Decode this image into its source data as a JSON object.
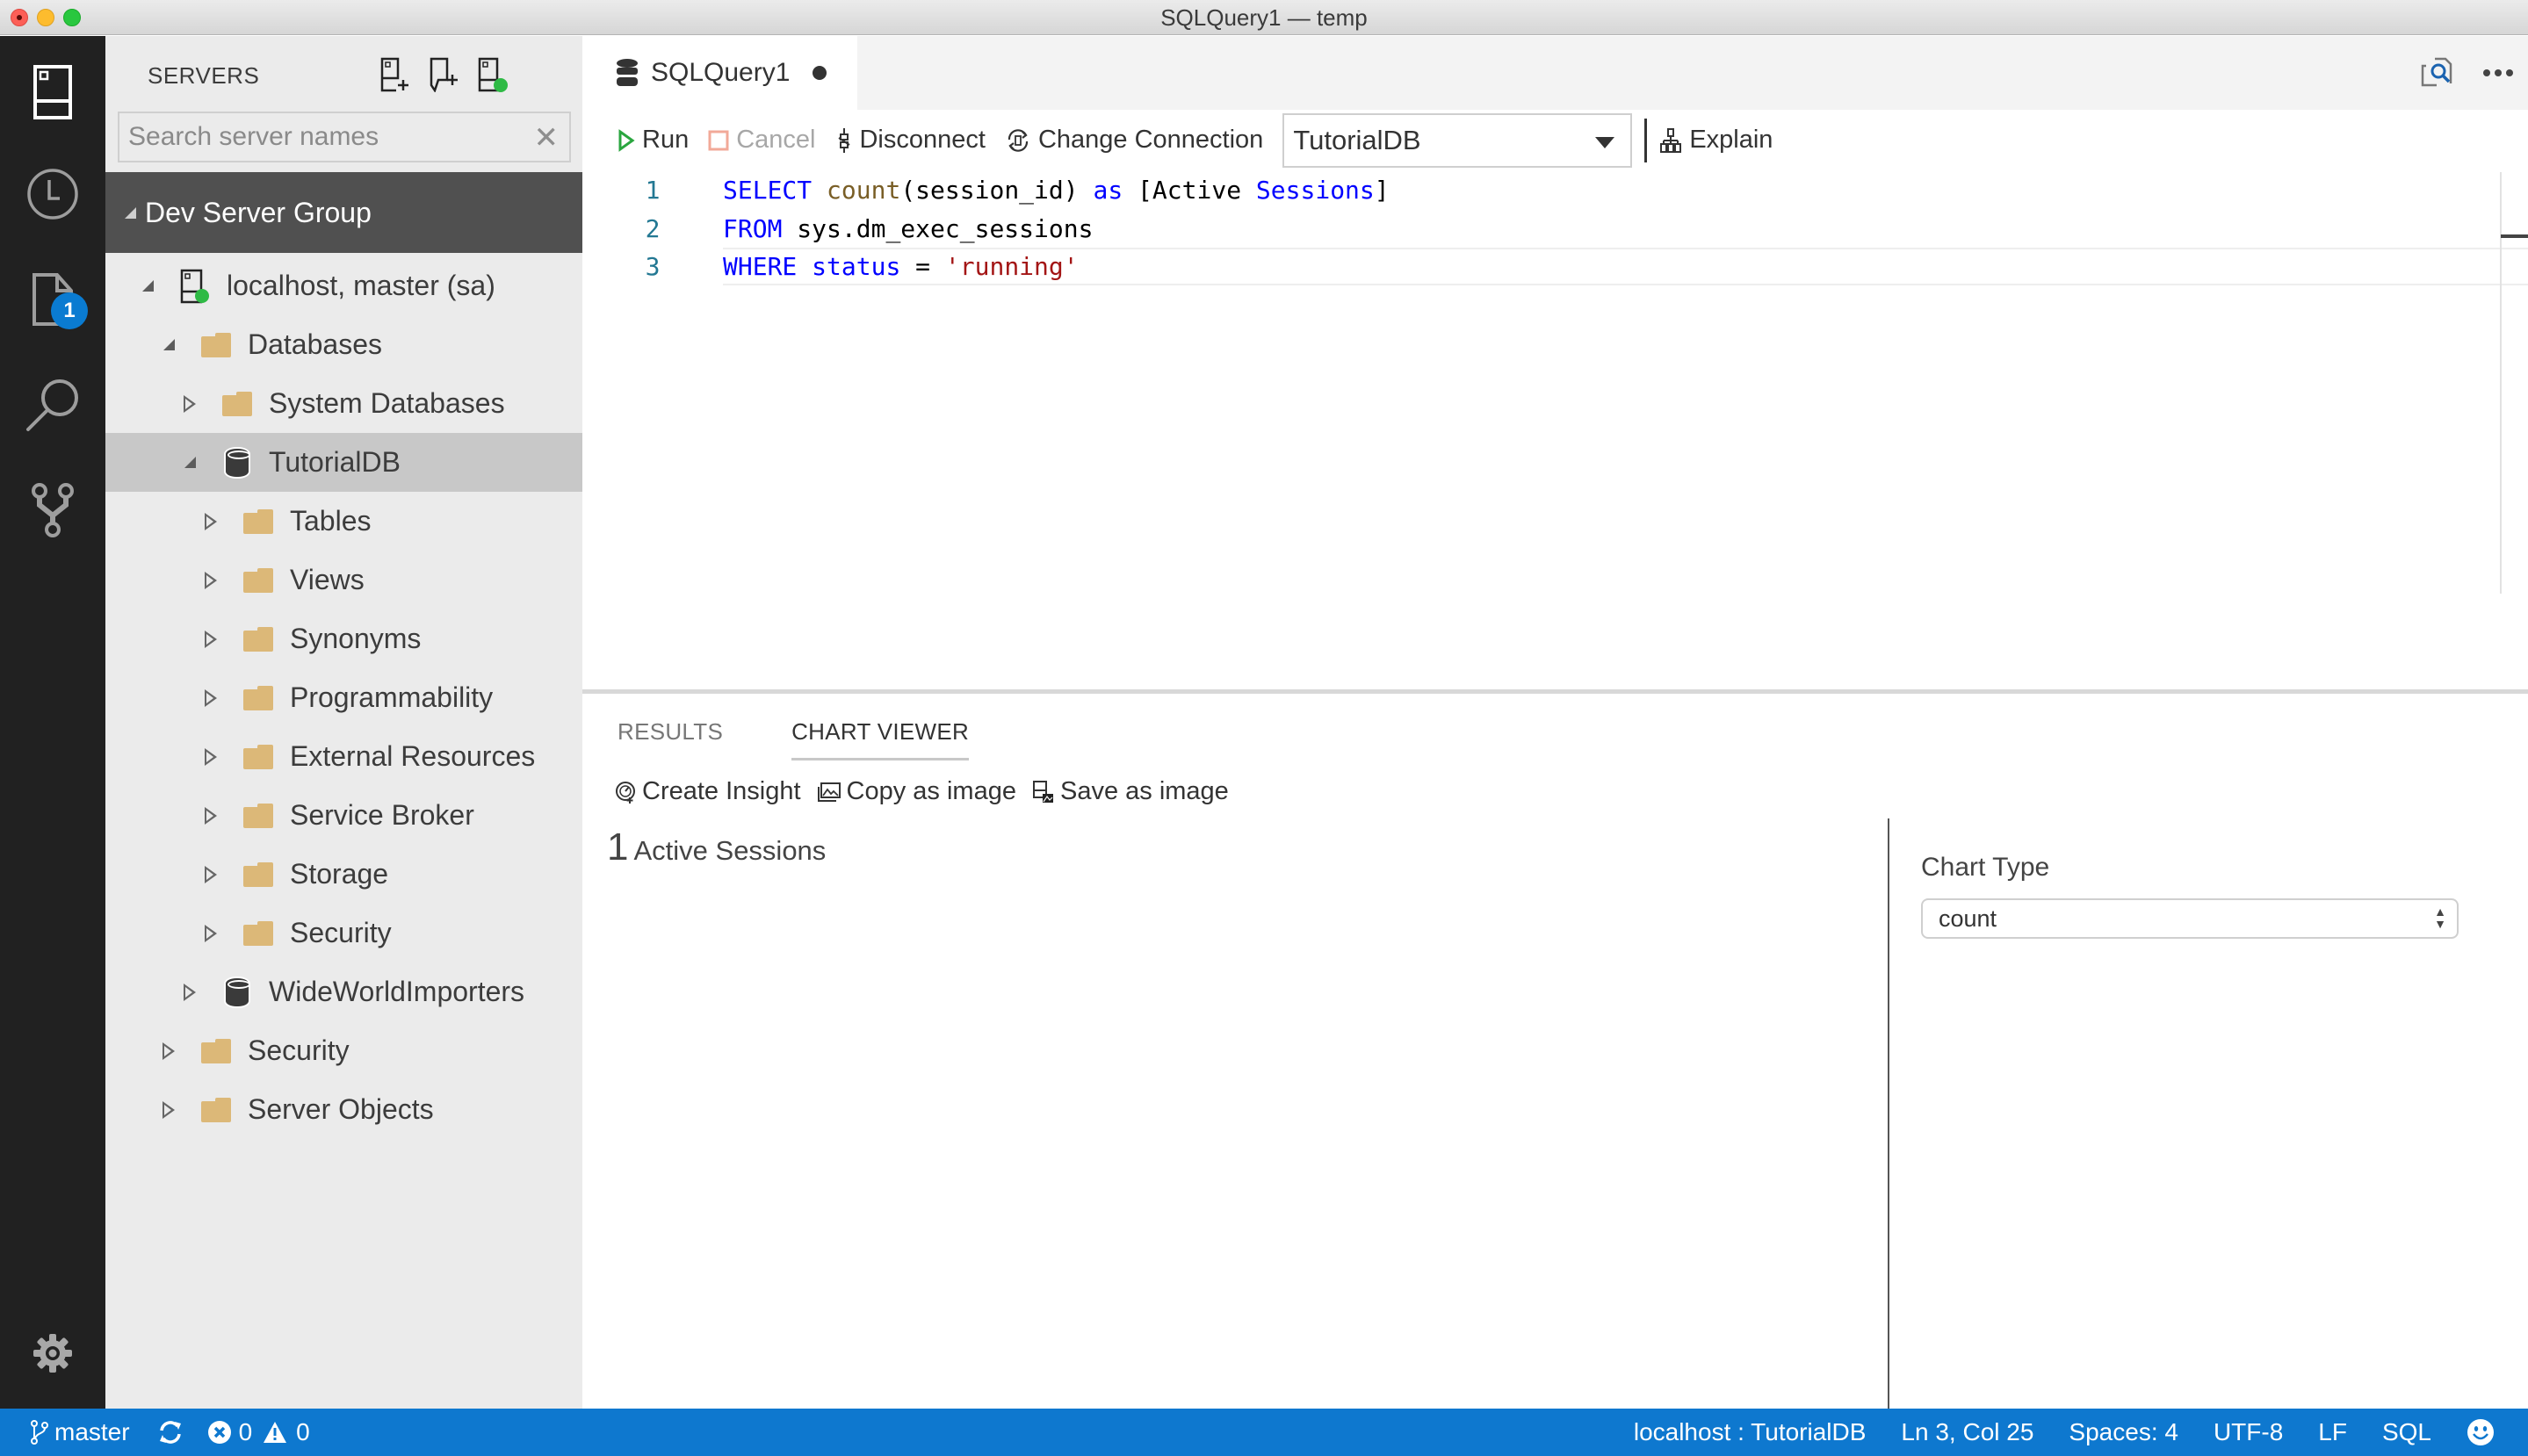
{
  "window": {
    "title": "SQLQuery1 — temp"
  },
  "activity_bar": {
    "items": [
      {
        "name": "servers",
        "icon": "server-icon"
      },
      {
        "name": "task-history",
        "icon": "clock-icon"
      },
      {
        "name": "explorer",
        "icon": "file-icon",
        "badge": "1"
      },
      {
        "name": "search",
        "icon": "search-icon"
      },
      {
        "name": "source-control",
        "icon": "git-branch-icon"
      }
    ],
    "settings_icon": "gear-icon"
  },
  "sidebar": {
    "title": "SERVERS",
    "actions": [
      {
        "name": "new-connection",
        "icon": "add-server-icon"
      },
      {
        "name": "new-server-group",
        "icon": "add-group-icon"
      },
      {
        "name": "active-connections",
        "icon": "server-connected-icon"
      }
    ],
    "search": {
      "placeholder": "Search server names",
      "value": ""
    },
    "group": {
      "label": "Dev Server Group",
      "expanded": true
    },
    "tree": [
      {
        "label": "localhost, master (sa)",
        "level": 0,
        "expanded": true,
        "icon": "server-connected-icon"
      },
      {
        "label": "Databases",
        "level": 1,
        "expanded": true,
        "icon": "folder-icon"
      },
      {
        "label": "System Databases",
        "level": 2,
        "expanded": false,
        "icon": "folder-icon"
      },
      {
        "label": "TutorialDB",
        "level": 2,
        "expanded": true,
        "icon": "database-icon",
        "selected": true
      },
      {
        "label": "Tables",
        "level": 3,
        "expanded": false,
        "icon": "folder-icon"
      },
      {
        "label": "Views",
        "level": 3,
        "expanded": false,
        "icon": "folder-icon"
      },
      {
        "label": "Synonyms",
        "level": 3,
        "expanded": false,
        "icon": "folder-icon"
      },
      {
        "label": "Programmability",
        "level": 3,
        "expanded": false,
        "icon": "folder-icon"
      },
      {
        "label": "External Resources",
        "level": 3,
        "expanded": false,
        "icon": "folder-icon"
      },
      {
        "label": "Service Broker",
        "level": 3,
        "expanded": false,
        "icon": "folder-icon"
      },
      {
        "label": "Storage",
        "level": 3,
        "expanded": false,
        "icon": "folder-icon"
      },
      {
        "label": "Security",
        "level": 3,
        "expanded": false,
        "icon": "folder-icon"
      },
      {
        "label": "WideWorldImporters",
        "level": 2,
        "expanded": false,
        "icon": "database-icon"
      },
      {
        "label": "Security",
        "level": 1,
        "expanded": false,
        "icon": "folder-icon"
      },
      {
        "label": "Server Objects",
        "level": 1,
        "expanded": false,
        "icon": "folder-icon"
      }
    ]
  },
  "editor": {
    "tab": {
      "label": "SQLQuery1",
      "dirty": true,
      "icon": "database-icon"
    },
    "tab_actions": [
      {
        "name": "find-in-files",
        "icon": "search-document-icon"
      },
      {
        "name": "more-actions",
        "icon": "ellipsis-icon"
      }
    ],
    "toolbar": {
      "run_label": "Run",
      "cancel_label": "Cancel",
      "cancel_disabled": true,
      "disconnect_label": "Disconnect",
      "change_connection_label": "Change Connection",
      "database_selected": "TutorialDB",
      "explain_label": "Explain"
    },
    "lines": [
      {
        "number": "1",
        "tokens": [
          {
            "t": "SELECT",
            "c": "kw"
          },
          {
            "t": " ",
            "c": ""
          },
          {
            "t": "count",
            "c": "fn"
          },
          {
            "t": "(session_id) ",
            "c": ""
          },
          {
            "t": "as",
            "c": "kw"
          },
          {
            "t": " [Active ",
            "c": ""
          },
          {
            "t": "Sessions",
            "c": "kw"
          },
          {
            "t": "]",
            "c": ""
          }
        ]
      },
      {
        "number": "2",
        "tokens": [
          {
            "t": "FROM",
            "c": "kw"
          },
          {
            "t": " sys.dm_exec_sessions",
            "c": ""
          }
        ]
      },
      {
        "number": "3",
        "tokens": [
          {
            "t": "WHERE",
            "c": "kw"
          },
          {
            "t": " ",
            "c": ""
          },
          {
            "t": "status",
            "c": "kw"
          },
          {
            "t": " = ",
            "c": ""
          },
          {
            "t": "'running'",
            "c": "str"
          }
        ]
      }
    ],
    "current_line": 3
  },
  "panel": {
    "tabs": [
      {
        "label": "RESULTS",
        "active": false
      },
      {
        "label": "CHART VIEWER",
        "active": true
      }
    ],
    "chart_actions": [
      {
        "label": "Create Insight",
        "icon": "insight-icon"
      },
      {
        "label": "Copy as image",
        "icon": "copy-image-icon"
      },
      {
        "label": "Save as image",
        "icon": "save-image-icon"
      }
    ],
    "count": {
      "value": "1",
      "label": "Active Sessions"
    },
    "options": {
      "chart_type_label": "Chart Type",
      "chart_type_value": "count"
    }
  },
  "statusbar": {
    "branch": "master",
    "errors": "0",
    "warnings": "0",
    "connection": "localhost : TutorialDB",
    "position": "Ln 3, Col 25",
    "indent": "Spaces: 4",
    "encoding": "UTF-8",
    "eol": "LF",
    "language": "SQL",
    "feedback_icon": "smiley-icon"
  },
  "colors": {
    "accent": "#0e78cf",
    "activity_bar": "#212121",
    "sidebar": "#ebebeb",
    "group_header": "#505050",
    "folder": "#dcb878",
    "keyword": "#0000ff",
    "function": "#795e26",
    "string": "#a31515",
    "line_number": "#237893",
    "connected": "#2fba45"
  }
}
